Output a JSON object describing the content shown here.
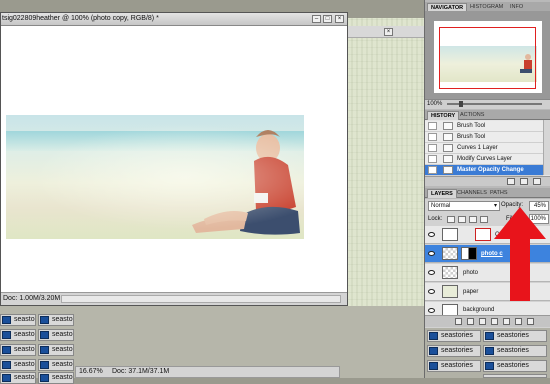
{
  "document": {
    "title": "tsig022809heather @ 100% (photo copy, RGB/8) *",
    "status_doc": "Doc: 1.00M/3.20M"
  },
  "bottom_status": {
    "zoom": "16.67%",
    "doc": "Doc: 37.1M/37.1M"
  },
  "taskbar": {
    "items": [
      "seastories",
      "seastories",
      "seastories",
      "seastories",
      "seastories",
      "seastories",
      "seastories",
      "seastories",
      "seastories",
      "seastories"
    ],
    "right_items": [
      "seastories",
      "seastories",
      "seastories",
      "seastories",
      "seastories",
      "seastories",
      "seastories"
    ]
  },
  "navigator": {
    "tabs": [
      "NAVIGATOR",
      "HISTOGRAM",
      "INFO"
    ],
    "zoom": "100%"
  },
  "history": {
    "tabs": [
      "HISTORY",
      "ACTIONS"
    ],
    "items": [
      {
        "label": "Brush Tool",
        "active": false
      },
      {
        "label": "Brush Tool",
        "active": false
      },
      {
        "label": "Curves 1 Layer",
        "active": false
      },
      {
        "label": "Modify Curves Layer",
        "active": false
      },
      {
        "label": "Master Opacity Change",
        "active": true
      }
    ]
  },
  "layers": {
    "tabs": [
      "LAYERS",
      "CHANNELS",
      "PATHS"
    ],
    "blend_mode": "Normal",
    "opacity_label": "Opacity:",
    "opacity": "45%",
    "lock_label": "Lock:",
    "fill_label": "Fill:",
    "fill": "100%",
    "items": [
      {
        "name": "Curv",
        "active": false
      },
      {
        "name": "photo c",
        "active": true
      },
      {
        "name": "photo",
        "active": false
      },
      {
        "name": "paper",
        "active": false
      },
      {
        "name": "background",
        "active": false
      }
    ]
  },
  "colors": {
    "accent_selected": "#3a7bd5",
    "arrow": "#e8141b",
    "nav_rect": "#e02020"
  },
  "icons": {
    "close": "close-icon",
    "minimize": "minimize-icon",
    "maximize": "maximize-icon",
    "eye": "eye-icon",
    "brush": "brush-icon",
    "arrow": "red-arrow-icon"
  }
}
